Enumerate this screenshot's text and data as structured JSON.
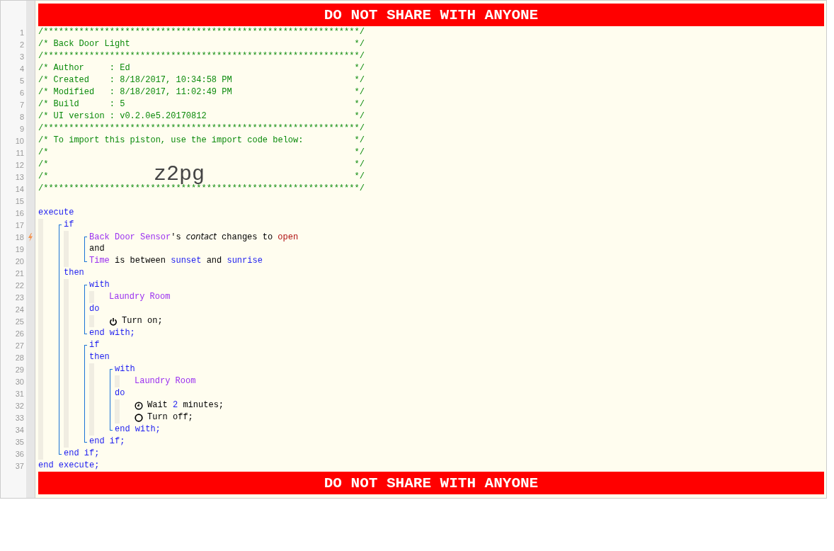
{
  "top_banner": "DO NOT SHARE WITH ANYONE",
  "code": [
    {
      "kind": "line",
      "no": "1",
      "trigger": false,
      "tokens": [
        {
          "kind": "comment",
          "text": "/**************************************************************/"
        }
      ]
    },
    {
      "kind": "line",
      "no": "2",
      "trigger": false,
      "tokens": [
        {
          "kind": "comment",
          "text": "/* Back Door Light"
        },
        {
          "kind": "comment_end",
          "text": "*/"
        }
      ]
    },
    {
      "kind": "line",
      "no": "3",
      "trigger": false,
      "tokens": [
        {
          "kind": "comment",
          "text": "/**************************************************************/"
        }
      ]
    },
    {
      "kind": "line",
      "no": "4",
      "trigger": false,
      "tokens": [
        {
          "kind": "comment",
          "text": "/* Author     : Ed"
        },
        {
          "kind": "comment_end",
          "text": "*/"
        }
      ]
    },
    {
      "kind": "line",
      "no": "5",
      "trigger": false,
      "tokens": [
        {
          "kind": "comment",
          "text": "/* Created    : 8/18/2017, 10:34:58 PM"
        },
        {
          "kind": "comment_end",
          "text": "*/"
        }
      ]
    },
    {
      "kind": "line",
      "no": "6",
      "trigger": false,
      "tokens": [
        {
          "kind": "comment",
          "text": "/* Modified   : 8/18/2017, 11:02:49 PM"
        },
        {
          "kind": "comment_end",
          "text": "*/"
        }
      ]
    },
    {
      "kind": "line",
      "no": "7",
      "trigger": false,
      "tokens": [
        {
          "kind": "comment",
          "text": "/* Build      : 5"
        },
        {
          "kind": "comment_end",
          "text": "*/"
        }
      ]
    },
    {
      "kind": "line",
      "no": "8",
      "trigger": false,
      "tokens": [
        {
          "kind": "comment",
          "text": "/* UI version : v0.2.0e5.20170812"
        },
        {
          "kind": "comment_end",
          "text": "*/"
        }
      ]
    },
    {
      "kind": "line",
      "no": "9",
      "trigger": false,
      "tokens": [
        {
          "kind": "comment",
          "text": "/**************************************************************/"
        }
      ]
    },
    {
      "kind": "line",
      "no": "10",
      "trigger": false,
      "tokens": [
        {
          "kind": "comment",
          "text": "/* To import this piston, use the import code below:"
        },
        {
          "kind": "comment_end",
          "text": "*/"
        }
      ]
    },
    {
      "kind": "line",
      "no": "11",
      "trigger": false,
      "tokens": [
        {
          "kind": "comment",
          "text": "/*"
        },
        {
          "kind": "comment_end",
          "text": "*/"
        }
      ]
    },
    {
      "kind": "line",
      "no": "12",
      "trigger": false,
      "tokens": [
        {
          "kind": "comment",
          "text": "/*"
        },
        {
          "kind": "comment_end",
          "text": "*/"
        }
      ]
    },
    {
      "kind": "line",
      "no": "13",
      "trigger": false,
      "tokens": [
        {
          "kind": "comment",
          "text": "/*"
        },
        {
          "kind": "comment_end",
          "text": "*/"
        }
      ]
    },
    {
      "kind": "line",
      "no": "14",
      "trigger": false,
      "tokens": [
        {
          "kind": "comment",
          "text": "/**************************************************************/"
        }
      ]
    },
    {
      "kind": "line",
      "no": "15",
      "trigger": false
    },
    {
      "kind": "line",
      "no": "16",
      "trigger": false,
      "tokens": [
        {
          "kind": "keyword",
          "text": "execute"
        }
      ]
    },
    {
      "kind": "block",
      "children": [
        {
          "kind": "statement",
          "children": [
            {
              "kind": "line",
              "no": "17",
              "trigger": false,
              "tokens": [
                {
                  "kind": "keyword",
                  "text": "if"
                }
              ]
            },
            {
              "kind": "block",
              "children": [
                {
                  "kind": "statement",
                  "children": [
                    {
                      "kind": "line",
                      "no": "18",
                      "trigger": true,
                      "tokens": [
                        {
                          "kind": "device",
                          "text": "Back Door Sensor"
                        },
                        {
                          "kind": "text",
                          "text": "'s "
                        },
                        {
                          "kind": "attribute",
                          "text": "contact"
                        },
                        {
                          "kind": "text",
                          "text": " changes to "
                        },
                        {
                          "kind": "value",
                          "text": "open"
                        }
                      ]
                    },
                    {
                      "kind": "line",
                      "no": "19",
                      "trigger": false,
                      "tokens": [
                        {
                          "kind": "text",
                          "text": "and"
                        }
                      ]
                    },
                    {
                      "kind": "line",
                      "no": "20",
                      "trigger": false,
                      "tokens": [
                        {
                          "kind": "device",
                          "text": "Time"
                        },
                        {
                          "kind": "text",
                          "text": " is between "
                        },
                        {
                          "kind": "constant",
                          "text": "sunset"
                        },
                        {
                          "kind": "text",
                          "text": " and "
                        },
                        {
                          "kind": "constant",
                          "text": "sunrise"
                        }
                      ]
                    }
                  ]
                }
              ]
            },
            {
              "kind": "line",
              "no": "21",
              "trigger": false,
              "tokens": [
                {
                  "kind": "keyword",
                  "text": "then"
                }
              ]
            },
            {
              "kind": "block",
              "children": [
                {
                  "kind": "statement",
                  "children": [
                    {
                      "kind": "line",
                      "no": "22",
                      "trigger": false,
                      "tokens": [
                        {
                          "kind": "keyword",
                          "text": "with"
                        }
                      ]
                    },
                    {
                      "kind": "block",
                      "children": [
                        {
                          "kind": "line",
                          "no": "23",
                          "trigger": false,
                          "tokens": [
                            {
                              "kind": "device",
                              "text": "Laundry Room"
                            }
                          ]
                        }
                      ]
                    },
                    {
                      "kind": "line",
                      "no": "24",
                      "trigger": false,
                      "tokens": [
                        {
                          "kind": "keyword",
                          "text": "do"
                        }
                      ]
                    },
                    {
                      "kind": "block",
                      "children": [
                        {
                          "kind": "line",
                          "no": "25",
                          "trigger": false,
                          "tokens": [
                            {
                              "kind": "icon_power"
                            },
                            {
                              "kind": "text",
                              "text": "Turn on;"
                            }
                          ]
                        }
                      ]
                    },
                    {
                      "kind": "line",
                      "no": "26",
                      "trigger": false,
                      "tokens": [
                        {
                          "kind": "keyword",
                          "text": "end with;"
                        }
                      ]
                    }
                  ]
                },
                {
                  "kind": "statement",
                  "children": [
                    {
                      "kind": "line",
                      "no": "27",
                      "trigger": false,
                      "tokens": [
                        {
                          "kind": "keyword",
                          "text": "if"
                        }
                      ]
                    },
                    {
                      "kind": "line",
                      "no": "28",
                      "trigger": false,
                      "tokens": [
                        {
                          "kind": "keyword",
                          "text": "then"
                        }
                      ]
                    },
                    {
                      "kind": "block",
                      "children": [
                        {
                          "kind": "statement",
                          "children": [
                            {
                              "kind": "line",
                              "no": "29",
                              "trigger": false,
                              "tokens": [
                                {
                                  "kind": "keyword",
                                  "text": "with"
                                }
                              ]
                            },
                            {
                              "kind": "block",
                              "children": [
                                {
                                  "kind": "line",
                                  "no": "30",
                                  "trigger": false,
                                  "tokens": [
                                    {
                                      "kind": "device",
                                      "text": "Laundry Room"
                                    }
                                  ]
                                }
                              ]
                            },
                            {
                              "kind": "line",
                              "no": "31",
                              "trigger": false,
                              "tokens": [
                                {
                                  "kind": "keyword",
                                  "text": "do"
                                }
                              ]
                            },
                            {
                              "kind": "block",
                              "children": [
                                {
                                  "kind": "line",
                                  "no": "32",
                                  "trigger": false,
                                  "tokens": [
                                    {
                                      "kind": "icon_timer"
                                    },
                                    {
                                      "kind": "text",
                                      "text": "Wait "
                                    },
                                    {
                                      "kind": "constant",
                                      "text": "2"
                                    },
                                    {
                                      "kind": "text",
                                      "text": " minutes;"
                                    }
                                  ]
                                },
                                {
                                  "kind": "line",
                                  "no": "33",
                                  "trigger": false,
                                  "tokens": [
                                    {
                                      "kind": "icon_ring"
                                    },
                                    {
                                      "kind": "text",
                                      "text": "Turn off;"
                                    }
                                  ]
                                }
                              ]
                            },
                            {
                              "kind": "line",
                              "no": "34",
                              "trigger": false,
                              "tokens": [
                                {
                                  "kind": "keyword",
                                  "text": "end with;"
                                }
                              ]
                            }
                          ]
                        }
                      ]
                    },
                    {
                      "kind": "line",
                      "no": "35",
                      "trigger": false,
                      "tokens": [
                        {
                          "kind": "keyword",
                          "text": "end if;"
                        }
                      ]
                    }
                  ]
                }
              ]
            },
            {
              "kind": "line",
              "no": "36",
              "trigger": false,
              "tokens": [
                {
                  "kind": "keyword",
                  "text": "end if;"
                }
              ]
            }
          ]
        }
      ]
    },
    {
      "kind": "line",
      "no": "37",
      "trigger": false,
      "tokens": [
        {
          "kind": "keyword",
          "text": "end execute;"
        }
      ]
    }
  ],
  "import_code": "z2pg",
  "bottom_banner": "DO NOT SHARE WITH ANYONE"
}
